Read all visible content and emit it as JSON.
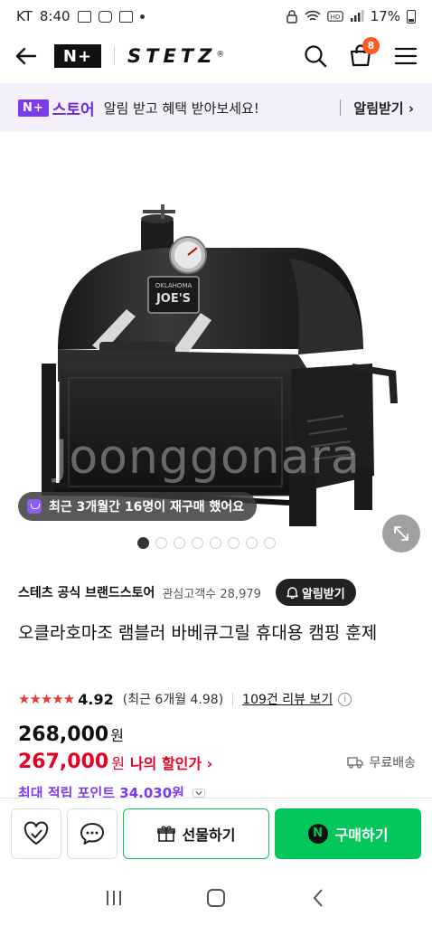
{
  "status_bar": {
    "carrier": "KT",
    "time": "8:40",
    "battery": "17%"
  },
  "header": {
    "nplus_label": "N+",
    "brand_name": "STETZ",
    "brand_reg": "®",
    "cart_count": "8"
  },
  "promo": {
    "nplus_label": "N+",
    "store_label": "스토어",
    "text": "알림 받고 혜택 받아보세요!",
    "button_label": "알림받기 ›"
  },
  "product_image": {
    "watermark": "Joonggonara",
    "repurchase_text": "최근 3개월간 16명이 재구매 했어요",
    "slide_count": 8,
    "active_slide": 0,
    "plaque_top": "OKLAHOMA",
    "plaque_main": "JOE'S"
  },
  "store": {
    "name": "스테츠 공식 브랜드스토어",
    "fans_label": "관심고객수",
    "fans_count": "28,979",
    "alarm_label": "알림받기"
  },
  "product": {
    "title": "오클라호마조 램블러 바베큐그릴 휴대용 캠핑 훈제"
  },
  "rating": {
    "stars": "★★★★★",
    "value": "4.92",
    "recent": "(최근 6개월 4.98)",
    "review_link": "109건 리뷰 보기",
    "info": "i"
  },
  "price": {
    "original": "268,000",
    "currency": "원",
    "sale": "267,000",
    "sale_label": "나의 할인가 ›",
    "shipping": "무료배송",
    "points": "최대 적립 포인트 34,030원"
  },
  "bottom_bar": {
    "gift_label": "선물하기",
    "buy_label": "구매하기",
    "n_label": "N"
  },
  "colors": {
    "accent_green": "#03c75a",
    "sale_red": "#e60023",
    "naver_purple": "#7c3aed",
    "badge_orange": "#ff5a1f"
  }
}
